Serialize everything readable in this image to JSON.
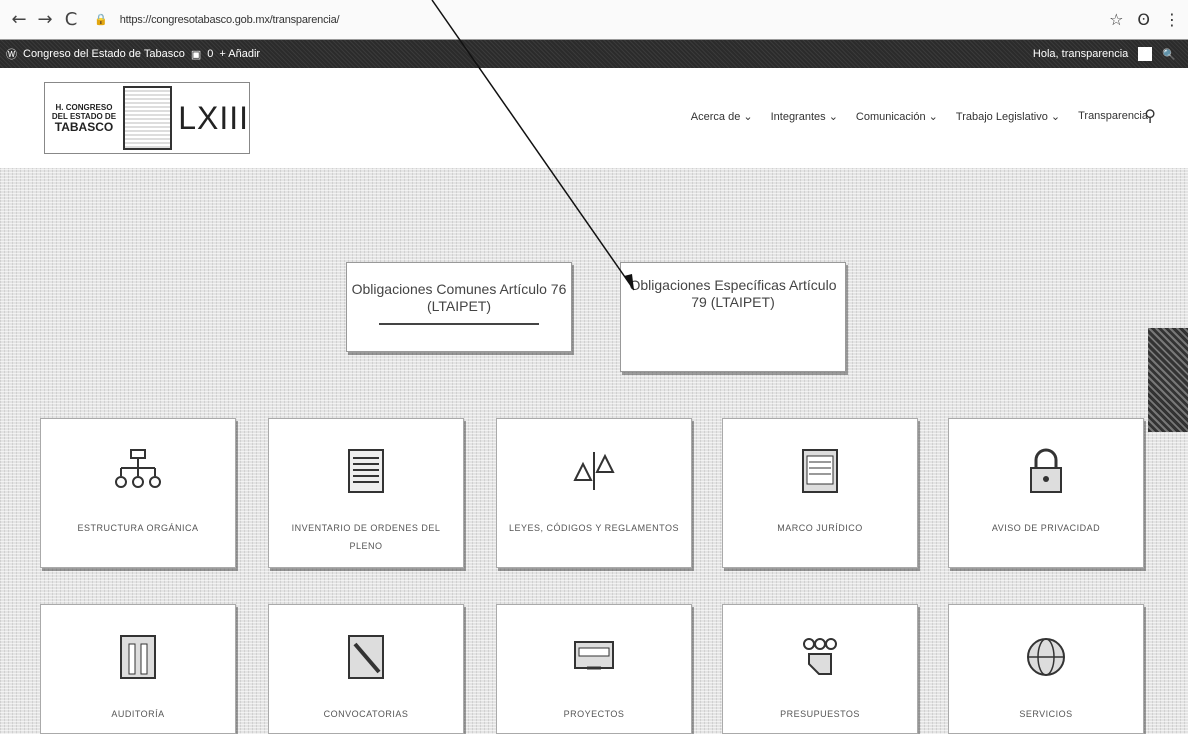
{
  "browser": {
    "url": "https://congresotabasco.gob.mx/transparencia/",
    "back": "←",
    "forward": "→",
    "reload": "C",
    "star": "☆",
    "menu": "⋮"
  },
  "admin_bar": {
    "site_name": "Congreso del Estado de Tabasco",
    "comments": "0",
    "add": "+ Añadir",
    "greeting": "Hola, transparencia"
  },
  "header": {
    "logo_line1": "H. CONGRESO",
    "logo_line2": "DEL ESTADO DE",
    "logo_line3": "TABASCO",
    "legislature": "LXIII",
    "nav": [
      "Acerca de ⌄",
      "Integrantes ⌄",
      "Comunicación ⌄",
      "Trabajo Legislativo ⌄",
      "Transparencia"
    ]
  },
  "obligations": {
    "common": "Obligaciones Comunes Artículo 76 (LTAIPET)",
    "specific": "Obligaciones Específicas Artículo 79 (LTAIPET)"
  },
  "tiles_row1": [
    {
      "icon": "org-chart-icon",
      "label": "ESTRUCTURA ORGÁNICA"
    },
    {
      "icon": "document-icon",
      "label": "INVENTARIO DE ORDENES DEL PLENO"
    },
    {
      "icon": "scales-icon",
      "label": "LEYES, CÓDIGOS Y REGLAMENTOS"
    },
    {
      "icon": "notebook-icon",
      "label": "MARCO JURÍDICO"
    },
    {
      "icon": "lock-icon",
      "label": "AVISO DE PRIVACIDAD"
    }
  ],
  "tiles_row2": [
    {
      "icon": "column-icon",
      "label": "AUDITORÍA"
    },
    {
      "icon": "pencil-icon",
      "label": "CONVOCATORIAS"
    },
    {
      "icon": "monitor-icon",
      "label": "PROYECTOS"
    },
    {
      "icon": "people-icon",
      "label": "PRESUPUESTOS"
    },
    {
      "icon": "globe-icon",
      "label": "SERVICIOS"
    }
  ]
}
